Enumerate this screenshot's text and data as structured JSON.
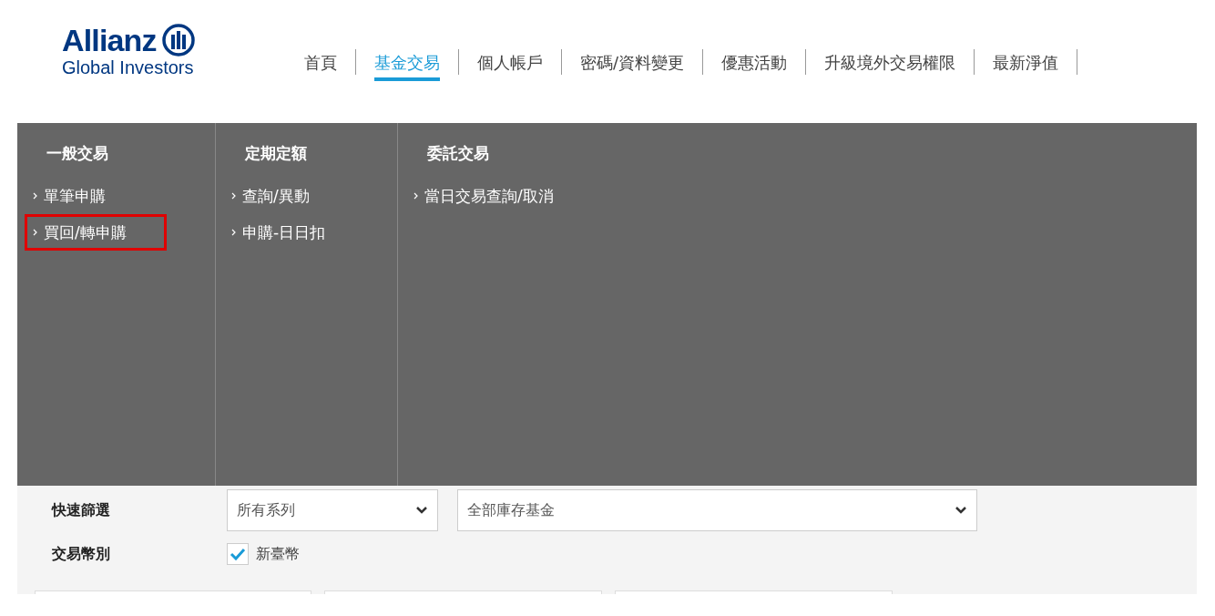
{
  "logo": {
    "brand": "Allianz",
    "subtitle": "Global Investors"
  },
  "nav": [
    {
      "label": "首頁",
      "selected": false
    },
    {
      "label": "基金交易",
      "selected": true
    },
    {
      "label": "個人帳戶",
      "selected": false
    },
    {
      "label": "密碼/資料變更",
      "selected": false
    },
    {
      "label": "優惠活動",
      "selected": false
    },
    {
      "label": "升級境外交易權限",
      "selected": false
    },
    {
      "label": "最新淨值",
      "selected": false
    }
  ],
  "menu": [
    {
      "heading": "一般交易",
      "items": [
        {
          "label": "單筆申購",
          "highlighted": false
        },
        {
          "label": "買回/轉申購",
          "highlighted": true
        }
      ]
    },
    {
      "heading": "定期定額",
      "items": [
        {
          "label": "查詢/異動",
          "highlighted": false
        },
        {
          "label": "申購-日日扣",
          "highlighted": false
        }
      ]
    },
    {
      "heading": "委託交易",
      "items": [
        {
          "label": "當日交易查詢/取消",
          "highlighted": false
        }
      ]
    }
  ],
  "filters": {
    "quick_filter": {
      "label": "快速篩選",
      "series": "所有系列",
      "funds": "全部庫存基金"
    },
    "currency": {
      "label": "交易幣別",
      "option": "新臺幣",
      "checked": true
    }
  }
}
